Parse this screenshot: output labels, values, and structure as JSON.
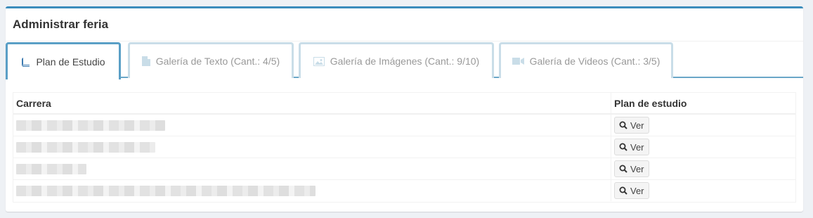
{
  "panel": {
    "title": "Administrar feria"
  },
  "tabs": [
    {
      "label": "Plan de Estudio",
      "icon": "book-icon",
      "active": true
    },
    {
      "label": "Galería de Texto (Cant.: 4/5)",
      "icon": "file-text-icon",
      "active": false
    },
    {
      "label": "Galería de Imágenes (Cant.: 9/10)",
      "icon": "image-icon",
      "active": false
    },
    {
      "label": "Galería de Videos (Cant.: 3/5)",
      "icon": "video-camera-icon",
      "active": false
    }
  ],
  "table": {
    "headers": {
      "carrera": "Carrera",
      "plan": "Plan de estudio"
    },
    "rows": [
      {
        "button_label": "Ver",
        "redacted": true
      },
      {
        "button_label": "Ver",
        "redacted": true
      },
      {
        "button_label": "Ver",
        "redacted": true
      },
      {
        "button_label": "Ver",
        "redacted": true
      }
    ]
  },
  "colors": {
    "accent": "#3c8dbc",
    "tab_border_active": "#5a9fc6",
    "tab_border_inactive": "#c9dde8"
  }
}
